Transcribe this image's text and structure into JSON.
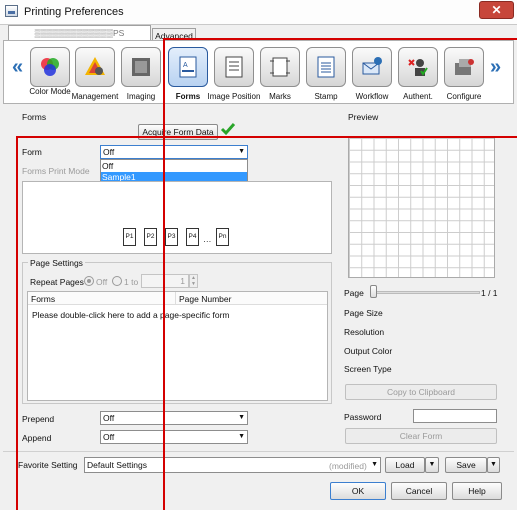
{
  "window": {
    "title": "Printing Preferences",
    "close_glyph": "✕"
  },
  "tabs": {
    "printer": "▒▒▒▒▒▒▒▒▒▒▒▒▒PS",
    "advanced": "Advanced"
  },
  "toolbar": {
    "left_arrow": "«",
    "right_arrow": "»",
    "items": [
      {
        "label": "Color Mode",
        "icon": "color-mode-icon"
      },
      {
        "label": "Management",
        "icon": "management-icon"
      },
      {
        "label": "Imaging",
        "icon": "imaging-icon"
      },
      {
        "label": "Forms",
        "icon": "forms-icon",
        "active": true
      },
      {
        "label": "Image Position",
        "icon": "image-position-icon"
      },
      {
        "label": "Marks",
        "icon": "marks-icon"
      },
      {
        "label": "Stamp",
        "icon": "stamp-icon"
      },
      {
        "label": "Workflow",
        "icon": "workflow-icon"
      },
      {
        "label": "Authent.",
        "icon": "authentication-icon"
      },
      {
        "label": "Configure",
        "icon": "configure-icon"
      }
    ]
  },
  "forms": {
    "group_title": "Forms",
    "acquire_button": "Acquire Form Data",
    "form_label": "Form",
    "form_value": "Off",
    "form_options": [
      "Off",
      "Sample1"
    ],
    "form_selected_option": "Sample1",
    "print_mode_label": "Forms Print Mode",
    "pages": [
      "P1",
      "P2",
      "P3",
      "P4",
      "…",
      "Pn"
    ]
  },
  "page_settings": {
    "title": "Page Settings",
    "repeat_label": "Repeat Pages",
    "off_label": "Off",
    "range_label": "1 to",
    "range_value": "1",
    "col_forms": "Forms",
    "col_page_number": "Page Number",
    "row_hint": "Please double-click here to add a page-specific form"
  },
  "prepend": {
    "label": "Prepend",
    "value": "Off"
  },
  "append": {
    "label": "Append",
    "value": "Off"
  },
  "preview": {
    "title": "Preview",
    "page_label": "Page",
    "page_count": "1 / 1",
    "info": [
      "Page Size",
      "Resolution",
      "Output Color",
      "Screen Type"
    ],
    "copy_button": "Copy to Clipboard",
    "password_label": "Password",
    "clear_button": "Clear Form"
  },
  "favorite": {
    "label": "Favorite Setting",
    "value": "Default Settings",
    "status": "(modified)",
    "load": "Load",
    "save": "Save"
  },
  "footer": {
    "ok": "OK",
    "cancel": "Cancel",
    "help": "Help"
  },
  "colors": {
    "accent": "#2c6fb5",
    "highlight": "#3399ff",
    "annotation": "#d40000",
    "check": "#2aa52a"
  }
}
